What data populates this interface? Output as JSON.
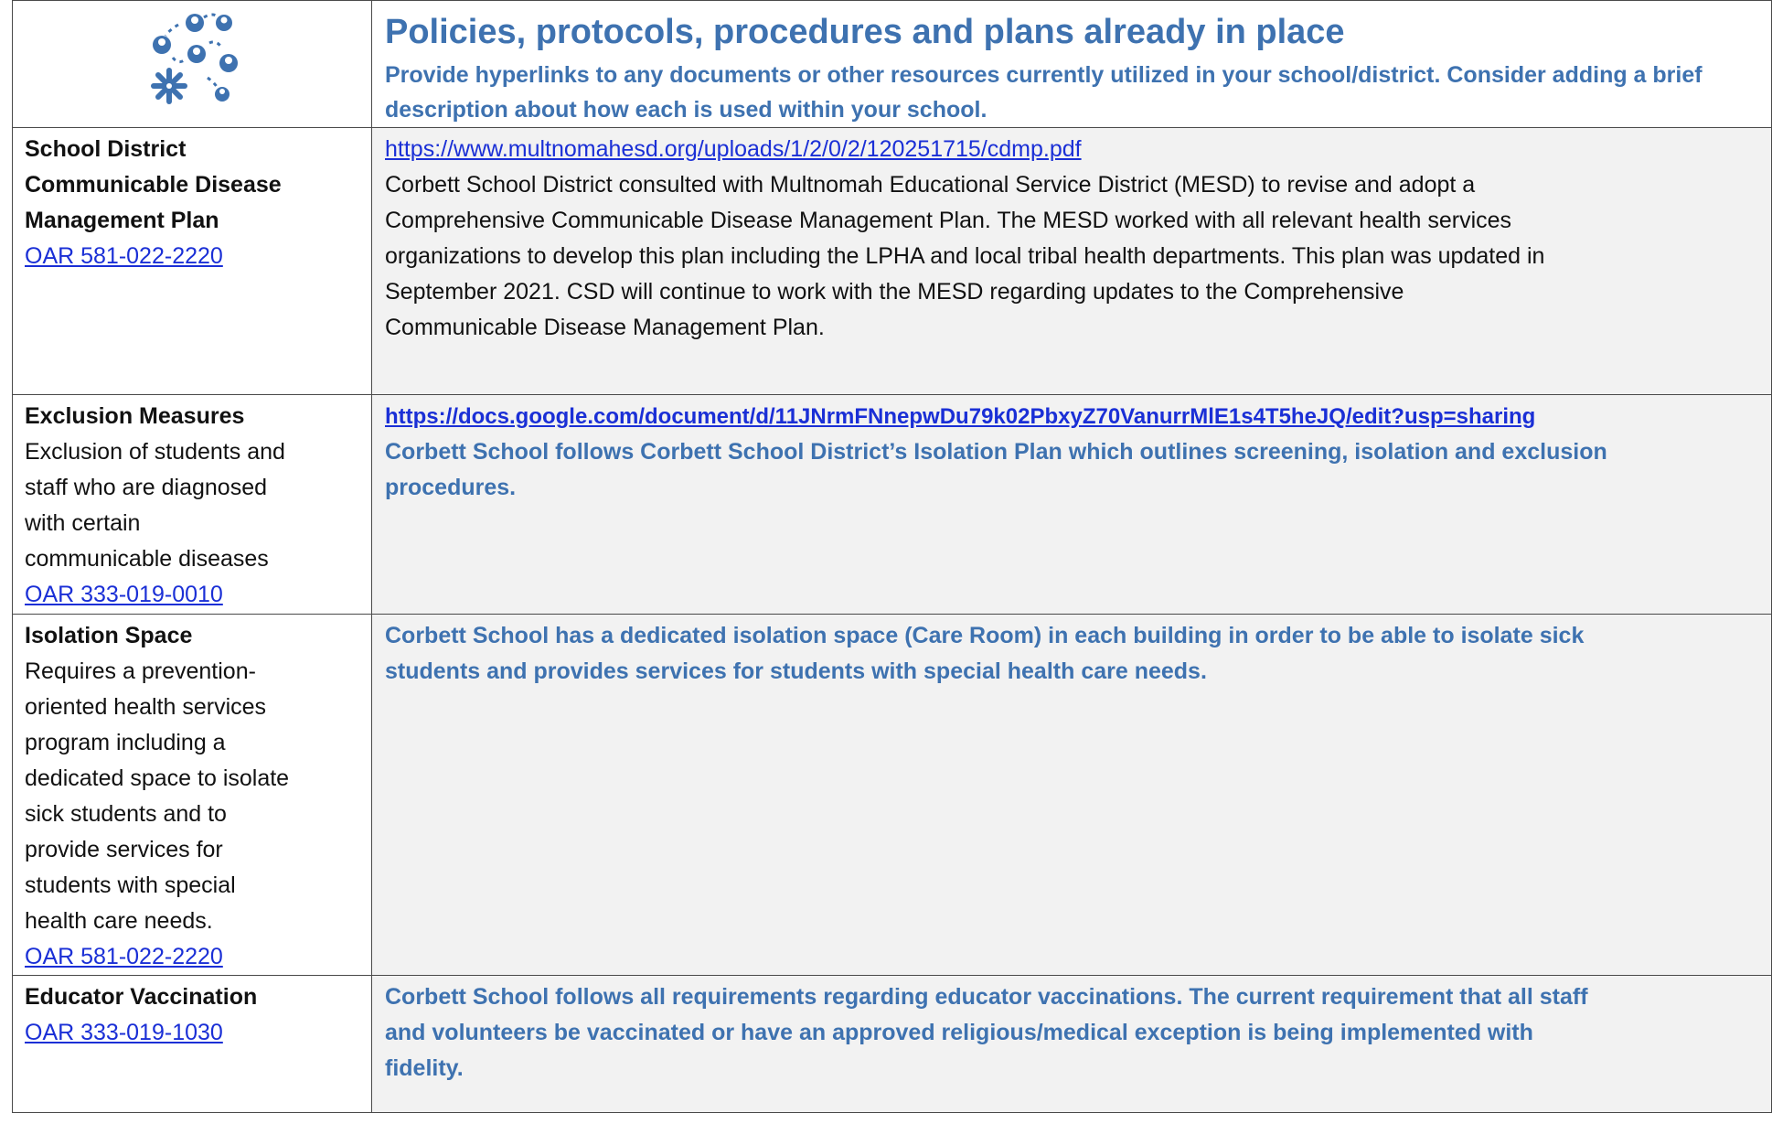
{
  "header": {
    "icon": "network-people-icon",
    "title": "Policies, protocols, procedures and plans already in place",
    "subtitle": "Provide hyperlinks to any documents or other resources currently utilized in your school/district. Consider adding a brief description about how each is used within your school."
  },
  "rows": [
    {
      "title_lines": [
        "School District",
        "Communicable Disease",
        "Management Plan"
      ],
      "desc_lines": [],
      "oar": "OAR 581-022-2220",
      "link": "https://www.multnomahesd.org/uploads/1/2/0/2/120251715/cdmp.pdf",
      "body_lines": [
        "Corbett School District consulted with Multnomah Educational Service District (MESD) to revise and adopt a",
        "Comprehensive Communicable Disease Management Plan. The MESD worked with all relevant health services",
        "organizations to develop this plan including the LPHA and local tribal health departments. This plan was updated in",
        "September 2021. CSD will continue to work with the MESD regarding updates to the Comprehensive",
        "Communicable Disease Management Plan."
      ]
    },
    {
      "title_lines": [
        "Exclusion Measures"
      ],
      "desc_lines": [
        "Exclusion of students and",
        "staff who are diagnosed",
        "with certain",
        "communicable diseases"
      ],
      "oar": "OAR 333-019-0010",
      "link": "https://docs.google.com/document/d/11JNrmFNnepwDu79k02PbxyZ70VanurrMlE1s4T5heJQ/edit?usp=sharing",
      "body_lines": [
        "Corbett School follows Corbett School District’s Isolation Plan which outlines screening, isolation and exclusion",
        "procedures."
      ]
    },
    {
      "title_lines": [
        "Isolation Space"
      ],
      "desc_lines": [
        "Requires a prevention-",
        "oriented health services",
        "program including a",
        "dedicated space to isolate",
        "sick students and to",
        "provide services for",
        "students with special",
        "health care needs."
      ],
      "oar": "OAR 581-022-2220",
      "link": "",
      "body_lines": [
        "Corbett School has a dedicated isolation space (Care Room) in each building in order to be able to isolate sick",
        "students and provides services for students with special health care needs."
      ]
    },
    {
      "title_lines": [
        "Educator Vaccination"
      ],
      "desc_lines": [],
      "oar": "OAR 333-019-1030",
      "link": "",
      "body_lines": [
        "Corbett School follows all requirements regarding educator vaccinations.  The current requirement that all staff",
        "and volunteers be vaccinated or have an approved religious/medical exception is being implemented with",
        "fidelity."
      ]
    }
  ]
}
